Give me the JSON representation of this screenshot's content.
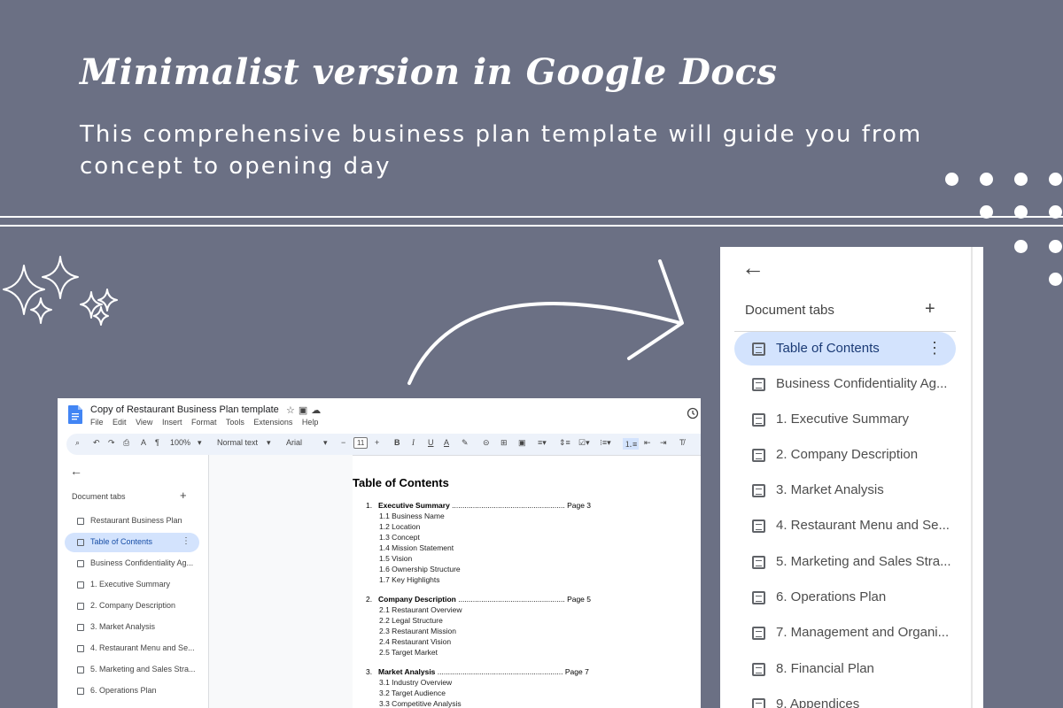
{
  "headline": "Minimalist version in Google Docs",
  "subline": "This comprehensive business plan template will guide you from concept to opening day",
  "doc": {
    "title": "Copy of Restaurant Business Plan template",
    "menu": [
      "File",
      "Edit",
      "View",
      "Insert",
      "Format",
      "Tools",
      "Extensions",
      "Help"
    ],
    "toolbar": {
      "zoom": "100%",
      "style": "Normal text",
      "font": "Arial",
      "font_size": "11"
    },
    "sidebar": {
      "heading": "Document tabs",
      "add": "+",
      "items": [
        {
          "label": "Restaurant Business Plan",
          "active": false
        },
        {
          "label": "Table of Contents",
          "active": true
        },
        {
          "label": "Business Confidentiality Ag...",
          "active": false
        },
        {
          "label": "1. Executive Summary",
          "active": false
        },
        {
          "label": "2. Company Description",
          "active": false
        },
        {
          "label": "3. Market Analysis",
          "active": false
        },
        {
          "label": "4. Restaurant Menu and Se...",
          "active": false
        },
        {
          "label": "5. Marketing and Sales Stra...",
          "active": false
        },
        {
          "label": "6. Operations Plan",
          "active": false
        }
      ]
    },
    "toc": {
      "title": "Table of Contents",
      "sections": [
        {
          "num": "1.",
          "title": "Executive Summary",
          "dots": "......................................................",
          "page": "Page 3",
          "subs": [
            "1.1 Business Name",
            "1.2 Location",
            "1.3 Concept",
            "1.4 Mission Statement",
            "1.5 Vision",
            "1.6 Ownership Structure",
            "1.7 Key Highlights"
          ]
        },
        {
          "num": "2.",
          "title": "Company Description",
          "dots": "...................................................",
          "page": "Page 5",
          "subs": [
            "2.1 Restaurant Overview",
            "2.2 Legal Structure",
            "2.3 Restaurant Mission",
            "2.4 Restaurant Vision",
            "2.5 Target Market"
          ]
        },
        {
          "num": "3.",
          "title": "Market Analysis",
          "dots": "............................................................",
          "page": "Page 7",
          "subs": [
            "3.1 Industry Overview",
            "3.2 Target Audience",
            "3.3 Competitive Analysis"
          ]
        }
      ]
    }
  },
  "zoom_panel": {
    "heading": "Document tabs",
    "add": "+",
    "items": [
      {
        "label": "Table of Contents",
        "active": true
      },
      {
        "label": "Business Confidentiality Ag...",
        "active": false
      },
      {
        "label": "1. Executive Summary",
        "active": false
      },
      {
        "label": "2. Company Description",
        "active": false
      },
      {
        "label": "3. Market Analysis",
        "active": false
      },
      {
        "label": "4. Restaurant Menu and Se...",
        "active": false
      },
      {
        "label": "5. Marketing and Sales Stra...",
        "active": false
      },
      {
        "label": "6. Operations Plan",
        "active": false
      },
      {
        "label": "7. Management and Organi...",
        "active": false
      },
      {
        "label": "8. Financial Plan",
        "active": false
      },
      {
        "label": "9. Appendices",
        "active": false
      }
    ]
  },
  "colors": {
    "background": "#6b7084",
    "active_tab": "#d3e3fd",
    "docs_blue": "#4285f4"
  }
}
